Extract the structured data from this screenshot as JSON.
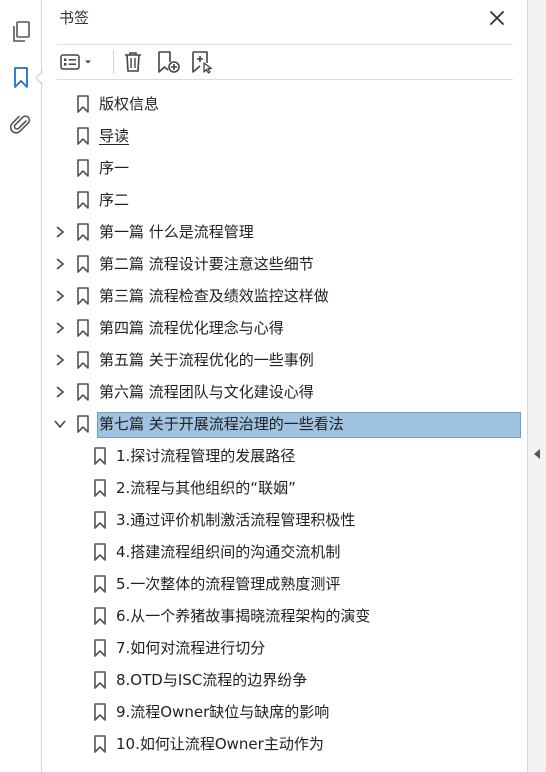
{
  "panel": {
    "title": "书签"
  },
  "left_toolbar": {
    "icons": [
      "pages-icon",
      "bookmark-icon",
      "attachment-icon"
    ],
    "active": "bookmark-icon"
  },
  "toolbar": {
    "icons": [
      "options-menu-icon",
      "delete-bookmark-icon",
      "new-bookmark-icon",
      "new-bookmark-from-structure-icon"
    ]
  },
  "colors": {
    "accent": "#1a73c8",
    "selection_bg": "#9ec2df",
    "selection_border": "#6f9ec3"
  },
  "bookmarks": [
    {
      "label": "版权信息",
      "level": 0,
      "expandable": false
    },
    {
      "label": "导读",
      "level": 0,
      "expandable": false,
      "underline": true
    },
    {
      "label": "序一",
      "level": 0,
      "expandable": false
    },
    {
      "label": "序二",
      "level": 0,
      "expandable": false
    },
    {
      "label": "第一篇 什么是流程管理",
      "level": 0,
      "expandable": true,
      "expanded": false
    },
    {
      "label": "第二篇 流程设计要注意这些细节",
      "level": 0,
      "expandable": true,
      "expanded": false
    },
    {
      "label": "第三篇 流程检查及绩效监控这样做",
      "level": 0,
      "expandable": true,
      "expanded": false
    },
    {
      "label": "第四篇 流程优化理念与心得",
      "level": 0,
      "expandable": true,
      "expanded": false
    },
    {
      "label": "第五篇 关于流程优化的一些事例",
      "level": 0,
      "expandable": true,
      "expanded": false
    },
    {
      "label": "第六篇 流程团队与文化建设心得",
      "level": 0,
      "expandable": true,
      "expanded": false
    },
    {
      "label": "第七篇 关于开展流程治理的一些看法",
      "level": 0,
      "expandable": true,
      "expanded": true,
      "selected": true
    },
    {
      "label": "1.探讨流程管理的发展路径",
      "level": 1,
      "expandable": false
    },
    {
      "label": "2.流程与其他组织的“联姻”",
      "level": 1,
      "expandable": false
    },
    {
      "label": "3.通过评价机制激活流程管理积极性",
      "level": 1,
      "expandable": false
    },
    {
      "label": "4.搭建流程组织间的沟通交流机制",
      "level": 1,
      "expandable": false
    },
    {
      "label": "5.一次整体的流程管理成熟度测评",
      "level": 1,
      "expandable": false
    },
    {
      "label": "6.从一个养猪故事揭晓流程架构的演变",
      "level": 1,
      "expandable": false
    },
    {
      "label": "7.如何对流程进行切分",
      "level": 1,
      "expandable": false
    },
    {
      "label": "8.OTD与ISC流程的边界纷争",
      "level": 1,
      "expandable": false
    },
    {
      "label": "9.流程Owner缺位与缺席的影响",
      "level": 1,
      "expandable": false
    },
    {
      "label": "10.如何让流程Owner主动作为",
      "level": 1,
      "expandable": false
    }
  ]
}
